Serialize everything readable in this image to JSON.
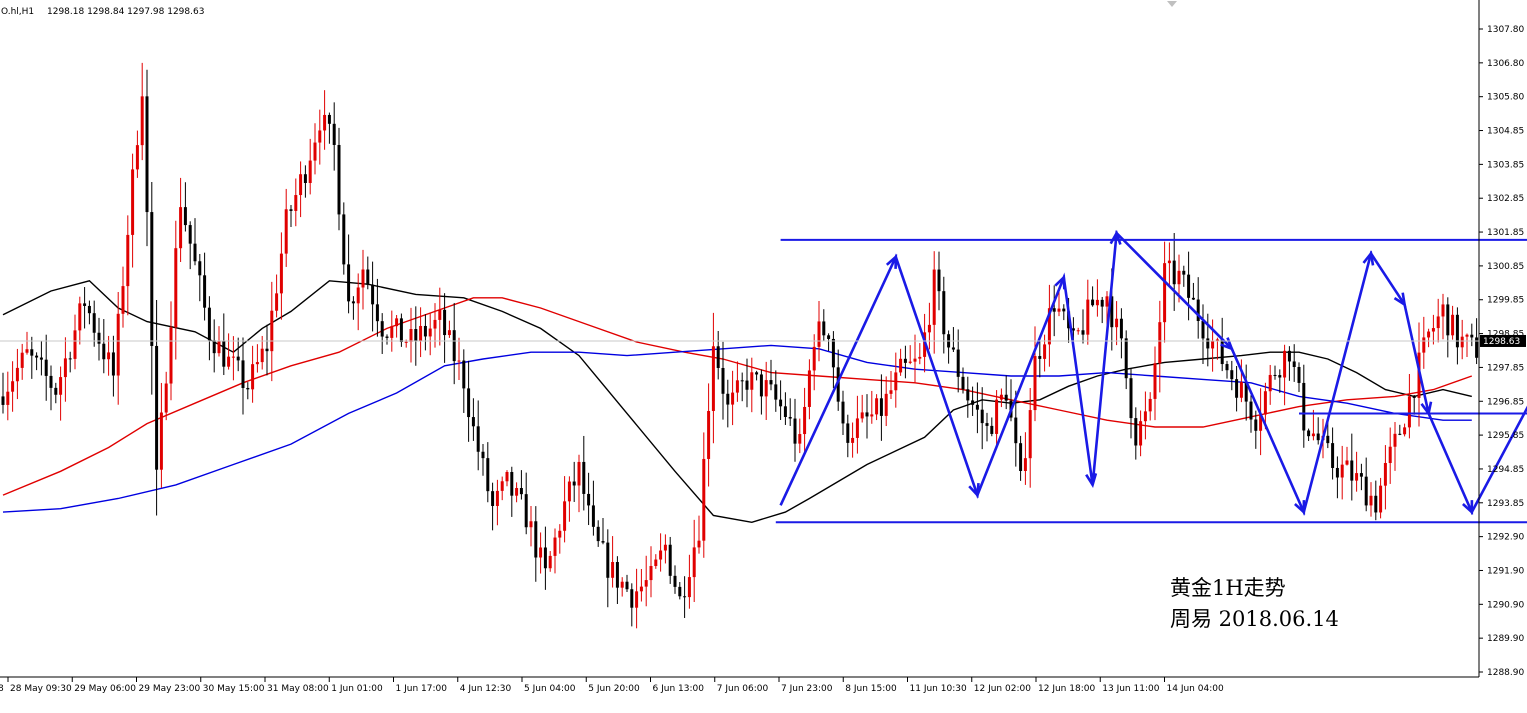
{
  "header": {
    "symbol": "O.hl,H1",
    "ohlc": "1298.18 1298.84 1297.98 1298.63"
  },
  "annotations": {
    "line1": "黄金1H走势",
    "line2": "周易  2018.06.14"
  },
  "colors": {
    "bull": "#e00000",
    "bear": "#000000",
    "ma_fast": "#000000",
    "ma_mid": "#e00000",
    "ma_slow": "#0000e0",
    "drawing": "#1a1ae6",
    "current_price_bg": "#000000",
    "current_price_text": "#ffffff"
  },
  "chart_data": {
    "type": "candlestick",
    "timeframe": "H1",
    "ylim": [
      1288.9,
      1307.8
    ],
    "y_ticks": [
      "1307.80",
      "1306.80",
      "1305.80",
      "1304.85",
      "1303.85",
      "1302.85",
      "1301.85",
      "1300.85",
      "1299.85",
      "1298.85",
      "1297.85",
      "1296.85",
      "1295.85",
      "1294.85",
      "1293.85",
      "1292.90",
      "1291.90",
      "1290.90",
      "1289.90",
      "1288.90"
    ],
    "current_price": "1298.63",
    "x_ticks": [
      "28 May 09:30",
      "29 May 06:00",
      "29 May 23:00",
      "30 May 15:00",
      "31 May 08:00",
      "1 Jun 01:00",
      "1 Jun 17:00",
      "4 Jun 12:30",
      "5 Jun 04:00",
      "5 Jun 20:00",
      "6 Jun 13:00",
      "7 Jun 06:00",
      "7 Jun 23:00",
      "8 Jun 15:00",
      "11 Jun 10:30",
      "12 Jun 02:00",
      "12 Jun 18:00",
      "13 Jun 11:00",
      "14 Jun 04:00"
    ],
    "price_path": [
      [
        0,
        1297.0
      ],
      [
        6,
        1298.2
      ],
      [
        12,
        1297.2
      ],
      [
        18,
        1299.8
      ],
      [
        24,
        1297.6
      ],
      [
        30,
        1306.2
      ],
      [
        33,
        1294.5
      ],
      [
        38,
        1302.8
      ],
      [
        44,
        1298.9
      ],
      [
        48,
        1298.0
      ],
      [
        52,
        1297.3
      ],
      [
        56,
        1298.5
      ],
      [
        60,
        1302.1
      ],
      [
        64,
        1303.7
      ],
      [
        67,
        1305.2
      ],
      [
        70,
        1304.3
      ],
      [
        73,
        1299.7
      ],
      [
        76,
        1300.8
      ],
      [
        80,
        1299.1
      ],
      [
        86,
        1298.6
      ],
      [
        92,
        1299.2
      ],
      [
        97,
        1297.5
      ],
      [
        99,
        1296.0
      ],
      [
        103,
        1293.7
      ],
      [
        106,
        1294.4
      ],
      [
        110,
        1293.5
      ],
      [
        114,
        1291.7
      ],
      [
        118,
        1293.8
      ],
      [
        121,
        1294.8
      ],
      [
        124,
        1292.8
      ],
      [
        128,
        1291.8
      ],
      [
        132,
        1291.2
      ],
      [
        136,
        1291.6
      ],
      [
        139,
        1292.6
      ],
      [
        142,
        1291.0
      ],
      [
        146,
        1293.2
      ],
      [
        149,
        1298.7
      ],
      [
        152,
        1296.6
      ],
      [
        156,
        1297.5
      ],
      [
        160,
        1297.2
      ],
      [
        164,
        1296.5
      ],
      [
        167,
        1295.5
      ],
      [
        170,
        1298.8
      ],
      [
        173,
        1299.0
      ],
      [
        176,
        1295.9
      ],
      [
        180,
        1296.2
      ],
      [
        184,
        1296.6
      ],
      [
        188,
        1297.7
      ],
      [
        192,
        1298.0
      ],
      [
        195,
        1300.3
      ],
      [
        198,
        1298.5
      ],
      [
        202,
        1297.0
      ],
      [
        206,
        1296.0
      ],
      [
        210,
        1297.2
      ],
      [
        213,
        1294.4
      ],
      [
        216,
        1298.0
      ],
      [
        220,
        1299.8
      ],
      [
        224,
        1298.5
      ],
      [
        228,
        1299.7
      ],
      [
        231,
        1300.0
      ],
      [
        234,
        1298.4
      ],
      [
        237,
        1295.9
      ],
      [
        240,
        1296.6
      ],
      [
        243,
        1300.6
      ],
      [
        246,
        1300.5
      ],
      [
        250,
        1299.4
      ],
      [
        254,
        1298.3
      ],
      [
        258,
        1297.4
      ],
      [
        262,
        1296.4
      ],
      [
        266,
        1297.8
      ],
      [
        269,
        1298.4
      ],
      [
        272,
        1296.3
      ],
      [
        275,
        1295.7
      ],
      [
        278,
        1295.0
      ],
      [
        281,
        1294.8
      ],
      [
        284,
        1294.4
      ],
      [
        287,
        1293.9
      ],
      [
        289,
        1294.8
      ],
      [
        292,
        1296.0
      ],
      [
        295,
        1297.4
      ],
      [
        298,
        1298.8
      ],
      [
        301,
        1299.5
      ],
      [
        304,
        1298.7
      ],
      [
        307,
        1298.4
      ]
    ],
    "moving_averages": [
      {
        "color": "#000000",
        "points": [
          [
            0,
            1299.4
          ],
          [
            10,
            1300.1
          ],
          [
            18,
            1300.4
          ],
          [
            24,
            1299.6
          ],
          [
            30,
            1299.2
          ],
          [
            40,
            1298.9
          ],
          [
            48,
            1298.3
          ],
          [
            54,
            1299.0
          ],
          [
            60,
            1299.5
          ],
          [
            68,
            1300.4
          ],
          [
            76,
            1300.3
          ],
          [
            86,
            1300.0
          ],
          [
            96,
            1299.9
          ],
          [
            104,
            1299.5
          ],
          [
            112,
            1299.0
          ],
          [
            120,
            1298.2
          ],
          [
            130,
            1296.5
          ],
          [
            140,
            1294.8
          ],
          [
            148,
            1293.5
          ],
          [
            156,
            1293.3
          ],
          [
            163,
            1293.6
          ],
          [
            168,
            1294.0
          ],
          [
            174,
            1294.5
          ],
          [
            180,
            1295.0
          ],
          [
            186,
            1295.4
          ],
          [
            192,
            1295.8
          ],
          [
            198,
            1296.6
          ],
          [
            204,
            1296.9
          ],
          [
            210,
            1296.8
          ],
          [
            216,
            1296.9
          ],
          [
            222,
            1297.3
          ],
          [
            228,
            1297.6
          ],
          [
            234,
            1297.8
          ],
          [
            242,
            1298.0
          ],
          [
            250,
            1298.1
          ],
          [
            258,
            1298.2
          ],
          [
            264,
            1298.3
          ],
          [
            270,
            1298.3
          ],
          [
            276,
            1298.1
          ],
          [
            282,
            1297.7
          ],
          [
            288,
            1297.2
          ],
          [
            294,
            1297.0
          ],
          [
            300,
            1297.2
          ],
          [
            306,
            1297.0
          ]
        ]
      },
      {
        "color": "#e00000",
        "points": [
          [
            0,
            1294.1
          ],
          [
            12,
            1294.8
          ],
          [
            22,
            1295.5
          ],
          [
            30,
            1296.2
          ],
          [
            40,
            1296.8
          ],
          [
            50,
            1297.4
          ],
          [
            60,
            1297.9
          ],
          [
            70,
            1298.3
          ],
          [
            80,
            1299.0
          ],
          [
            90,
            1299.5
          ],
          [
            98,
            1299.9
          ],
          [
            104,
            1299.9
          ],
          [
            112,
            1299.6
          ],
          [
            122,
            1299.1
          ],
          [
            132,
            1298.6
          ],
          [
            142,
            1298.3
          ],
          [
            150,
            1298.1
          ],
          [
            160,
            1297.7
          ],
          [
            170,
            1297.6
          ],
          [
            180,
            1297.5
          ],
          [
            190,
            1297.4
          ],
          [
            200,
            1297.2
          ],
          [
            210,
            1296.9
          ],
          [
            220,
            1296.6
          ],
          [
            230,
            1296.3
          ],
          [
            240,
            1296.1
          ],
          [
            250,
            1296.1
          ],
          [
            260,
            1296.4
          ],
          [
            270,
            1296.7
          ],
          [
            280,
            1296.9
          ],
          [
            290,
            1297.0
          ],
          [
            298,
            1297.2
          ],
          [
            306,
            1297.6
          ]
        ]
      },
      {
        "color": "#0000e0",
        "points": [
          [
            0,
            1293.6
          ],
          [
            12,
            1293.7
          ],
          [
            24,
            1294.0
          ],
          [
            36,
            1294.4
          ],
          [
            48,
            1295.0
          ],
          [
            60,
            1295.6
          ],
          [
            72,
            1296.5
          ],
          [
            82,
            1297.1
          ],
          [
            92,
            1297.9
          ],
          [
            100,
            1298.1
          ],
          [
            110,
            1298.3
          ],
          [
            120,
            1298.3
          ],
          [
            130,
            1298.2
          ],
          [
            140,
            1298.3
          ],
          [
            150,
            1298.4
          ],
          [
            160,
            1298.5
          ],
          [
            170,
            1298.4
          ],
          [
            180,
            1298.0
          ],
          [
            190,
            1297.8
          ],
          [
            200,
            1297.7
          ],
          [
            210,
            1297.6
          ],
          [
            220,
            1297.6
          ],
          [
            230,
            1297.7
          ],
          [
            240,
            1297.6
          ],
          [
            250,
            1297.5
          ],
          [
            260,
            1297.4
          ],
          [
            270,
            1297.0
          ],
          [
            280,
            1296.8
          ],
          [
            290,
            1296.5
          ],
          [
            300,
            1296.3
          ],
          [
            306,
            1296.3
          ]
        ]
      }
    ],
    "drawings": {
      "resistance": {
        "from": [
          162,
          1301.6
        ],
        "to": [
          328,
          1301.6
        ]
      },
      "support": {
        "from": [
          161,
          1293.3
        ],
        "to": [
          338,
          1293.3
        ]
      },
      "support_right": {
        "from": [
          270,
          1296.5
        ],
        "to": [
          333,
          1296.5
        ]
      },
      "zigzag": [
        [
          162,
          1293.8
        ],
        [
          186,
          1301.1
        ],
        [
          203,
          1294.1
        ],
        [
          221,
          1300.5
        ],
        [
          227,
          1294.4
        ],
        [
          232,
          1301.8
        ],
        [
          256,
          1298.4
        ],
        [
          271,
          1293.6
        ],
        [
          285,
          1301.2
        ],
        [
          292,
          1299.7
        ],
        [
          297,
          1296.5
        ],
        [
          306,
          1293.6
        ],
        [
          329,
          1299.7
        ]
      ]
    }
  }
}
